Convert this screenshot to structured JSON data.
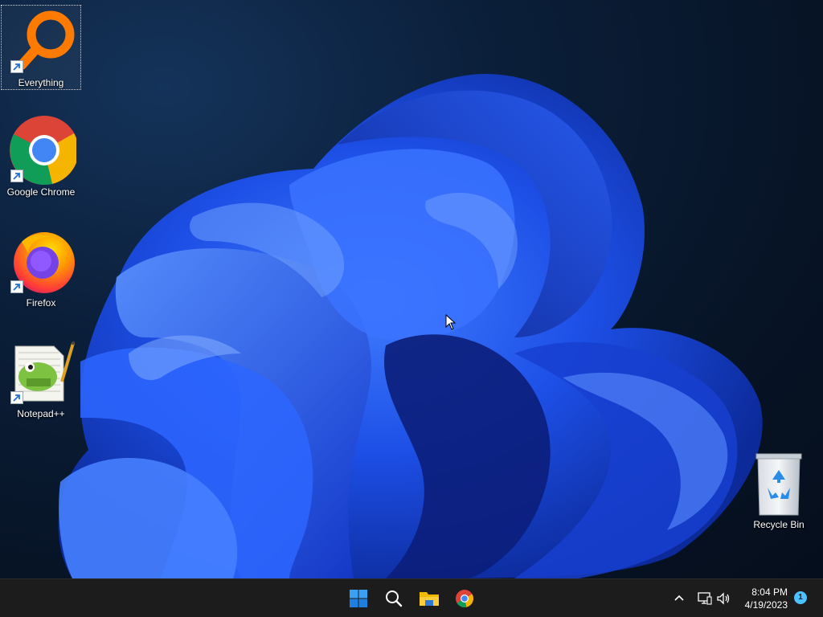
{
  "desktop": {
    "icons": [
      {
        "label": "Everything",
        "icon": "everything-magnifier-icon",
        "selected": true
      },
      {
        "label": "Google Chrome",
        "icon": "chrome-icon"
      },
      {
        "label": "Firefox",
        "icon": "firefox-icon"
      },
      {
        "label": "Notepad++",
        "icon": "notepadpp-icon"
      },
      {
        "label": "Recycle Bin",
        "icon": "recycle-bin-icon"
      }
    ]
  },
  "taskbar": {
    "pinned": [
      {
        "icon": "windows-start-icon"
      },
      {
        "icon": "search-icon"
      },
      {
        "icon": "file-explorer-icon"
      },
      {
        "icon": "chrome-icon"
      }
    ],
    "tray": {
      "icons": [
        "chevron-up-icon",
        "network-icon",
        "volume-icon"
      ],
      "time": "8:04 PM",
      "date": "4/19/2023",
      "notification_count": "1"
    }
  },
  "colors": {
    "accent": "#4cc2ff",
    "taskbar": "#1c1c1c",
    "wallpaper_bloom": "#1a4fe0"
  }
}
